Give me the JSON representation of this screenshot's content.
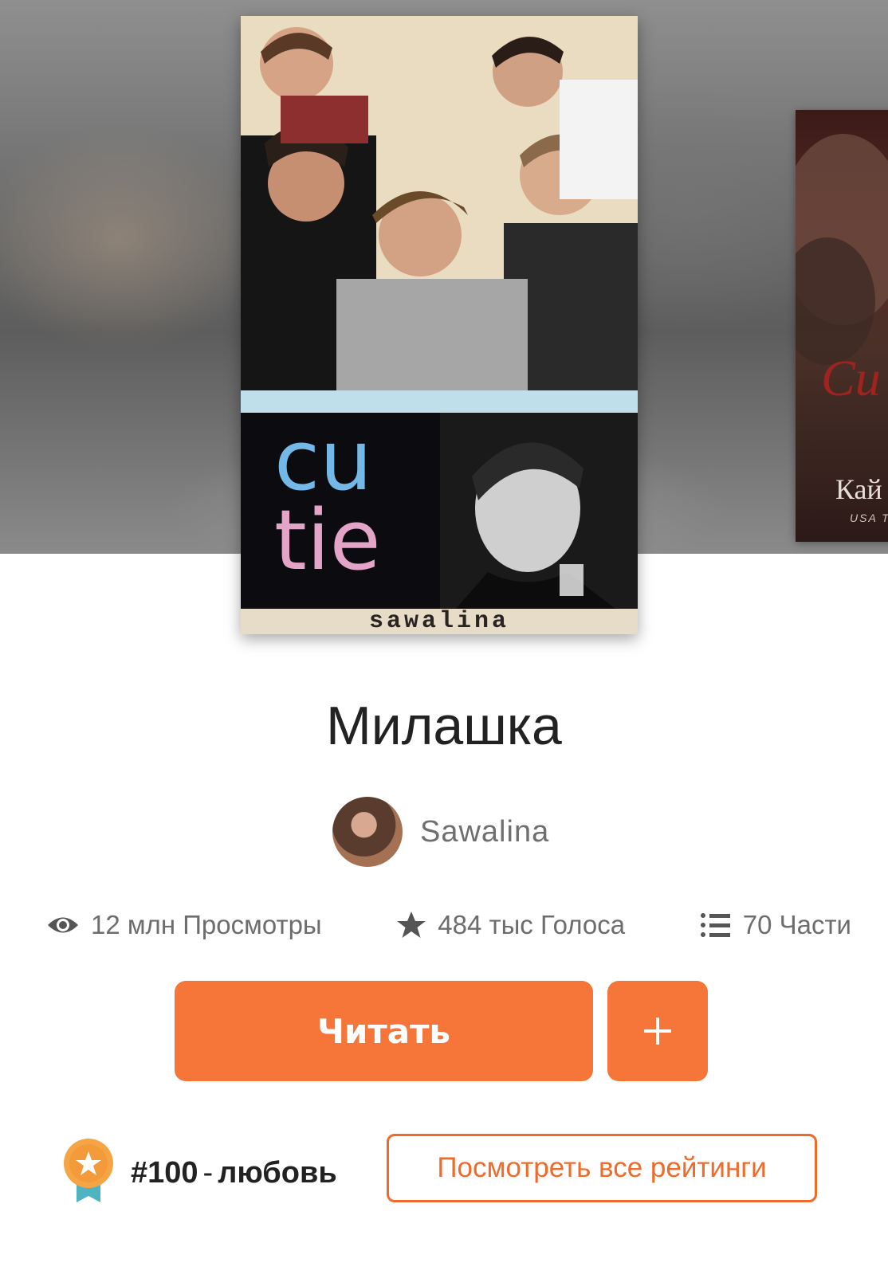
{
  "cover": {
    "word_top": "cu",
    "word_bottom": "tie",
    "author_signature": "sawalina"
  },
  "next_cover": {
    "title_fragment": "Cu",
    "author_fragment": "Кай",
    "tag_fragment": "USA T"
  },
  "story": {
    "title": "Милашка",
    "author": "Sawalina"
  },
  "stats": {
    "views": "12 млн Просмотры",
    "votes": "484 тыс Голоса",
    "parts": "70 Части"
  },
  "actions": {
    "read_label": "Читать",
    "add_label": "+"
  },
  "ranking": {
    "number": "#100",
    "separator": "-",
    "category": "любовь",
    "view_all_label": "Посмотреть все рейтинги"
  },
  "colors": {
    "accent": "#f57638",
    "accent_border": "#f06a2a",
    "badge_gold": "#f6a545",
    "badge_ribbon": "#4fb3c2"
  },
  "icons": [
    "eye-icon",
    "star-icon",
    "list-icon",
    "plus-icon",
    "award-badge-icon"
  ]
}
